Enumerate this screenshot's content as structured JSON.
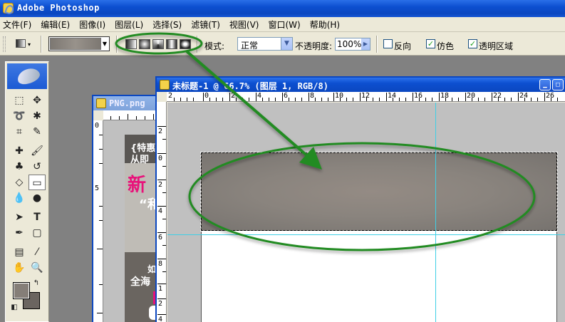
{
  "app": {
    "title": "Adobe Photoshop"
  },
  "menu": [
    "文件(F)",
    "编辑(E)",
    "图像(I)",
    "图层(L)",
    "选择(S)",
    "滤镜(T)",
    "视图(V)",
    "窗口(W)",
    "帮助(H)"
  ],
  "options": {
    "mode_label": "模式:",
    "mode_value": "正常",
    "opacity_label": "不透明度:",
    "opacity_value": "100%",
    "reverse_label": "反向",
    "reverse_checked": false,
    "dither_label": "仿色",
    "dither_checked": true,
    "transparency_label": "透明区域",
    "transparency_checked": true,
    "gradient_types": [
      "linear",
      "radial",
      "angle",
      "reflected",
      "diamond"
    ]
  },
  "toolbox": {
    "foreground_color": "#857e78",
    "background_color": "#6b6560",
    "tools": [
      "marquee",
      "move",
      "lasso",
      "magic-wand",
      "crop",
      "slice",
      "healing-brush",
      "brush",
      "clone-stamp",
      "history-brush",
      "eraser",
      "gradient",
      "blur",
      "dodge",
      "path-selection",
      "type",
      "pen",
      "shape",
      "notes",
      "eyedropper",
      "hand",
      "zoom"
    ],
    "type_tool_glyph": "T"
  },
  "back_document": {
    "title": "PNG.png",
    "ruler_v_labels": [
      "0",
      "5"
    ],
    "poster_lines": [
      "{特惠",
      "从即",
      "新",
      "“和",
      "如",
      "全海"
    ]
  },
  "front_document": {
    "title": "未标题-1 @ 66.7% (图层 1, RGB/8)",
    "ruler_h_labels": [
      "2",
      "0",
      "2",
      "4",
      "6",
      "8",
      "10",
      "12",
      "14",
      "16",
      "18",
      "20",
      "22",
      "24",
      "26"
    ],
    "ruler_v_labels": [
      "2",
      "0",
      "2",
      "4",
      "6",
      "8",
      "1",
      "2",
      "4"
    ]
  },
  "annotations": {
    "highlight_color": "#228B22"
  }
}
